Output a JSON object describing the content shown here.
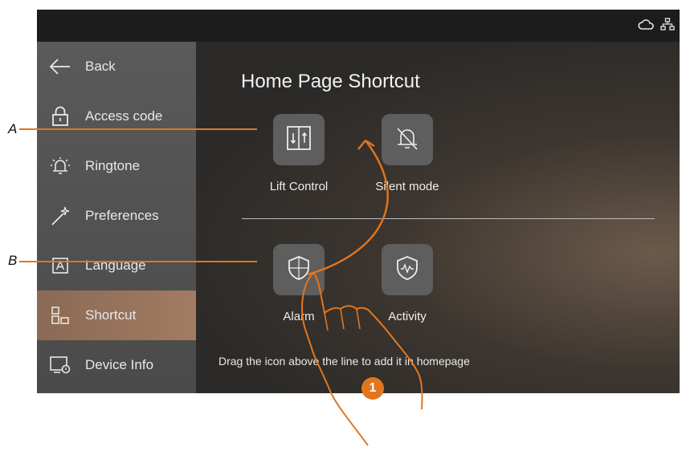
{
  "sidebar": {
    "items": [
      {
        "label": "Back",
        "icon": "arrow-left-icon"
      },
      {
        "label": "Access code",
        "icon": "lock-icon"
      },
      {
        "label": "Ringtone",
        "icon": "bell-icon"
      },
      {
        "label": "Preferences",
        "icon": "magic-wand-icon"
      },
      {
        "label": "Language",
        "icon": "language-icon"
      },
      {
        "label": "Shortcut",
        "icon": "shortcut-icon"
      },
      {
        "label": "Device Info",
        "icon": "device-info-icon"
      }
    ],
    "active_index": 5
  },
  "main": {
    "title": "Home Page Shortcut",
    "homepage_tiles": [
      {
        "label": "Lift Control",
        "icon": "lift-icon"
      },
      {
        "label": "Silent mode",
        "icon": "bell-off-icon"
      }
    ],
    "available_tiles": [
      {
        "label": "Alarm",
        "icon": "shield-icon"
      },
      {
        "label": "Activity",
        "icon": "shield-activity-icon"
      }
    ],
    "hint": "Drag the icon above the line to add it in homepage"
  },
  "status_icons": [
    "cloud-icon",
    "network-icon"
  ],
  "callouts": {
    "a": "A",
    "b": "B",
    "step": "1"
  },
  "colors": {
    "accent": "#e2761e",
    "active_item": "#a27b62",
    "sidebar": "#555555",
    "tile": "#5e5e5e"
  }
}
